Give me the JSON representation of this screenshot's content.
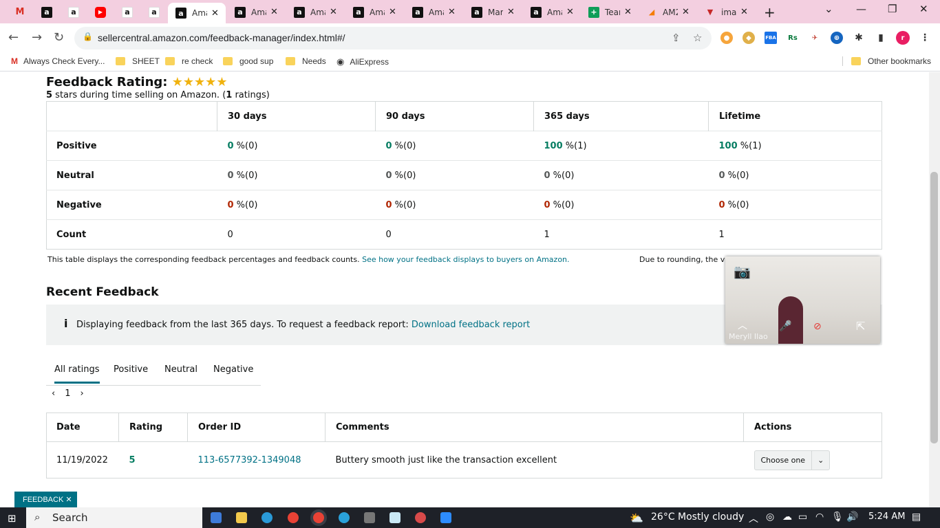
{
  "browser": {
    "tabs": [
      {
        "icon": "gmail-icon",
        "label": ""
      },
      {
        "icon": "amazon-icon",
        "label": ""
      },
      {
        "icon": "amazon-icon",
        "label": ""
      },
      {
        "icon": "youtube-icon",
        "label": ""
      },
      {
        "icon": "amazon-icon",
        "label": ""
      },
      {
        "icon": "amazon-icon",
        "label": ""
      },
      {
        "icon": "amazon-icon",
        "label": "Ama"
      },
      {
        "icon": "amazon-icon",
        "label": "Ama"
      },
      {
        "icon": "amazon-icon",
        "label": "Ama"
      },
      {
        "icon": "amazon-icon",
        "label": "Ama"
      },
      {
        "icon": "amazon-icon",
        "label": "Ama"
      },
      {
        "icon": "amazon-icon",
        "label": "Mar"
      },
      {
        "icon": "amazon-icon",
        "label": "Ama"
      },
      {
        "icon": "sheets-icon",
        "label": "Tear"
      },
      {
        "icon": "ams-icon",
        "label": "AM2"
      },
      {
        "icon": "image-icon",
        "label": "ima"
      }
    ],
    "url": "sellercentral.amazon.com/feedback-manager/index.html#/",
    "bookmarks": [
      "Always Check Every...",
      "SHEET",
      "re check",
      "good sup",
      "Needs",
      "AliExpress"
    ],
    "other_bookmarks": "Other bookmarks",
    "profile_initial": "r"
  },
  "feedback": {
    "title": "Feedback Rating:",
    "stars": "★★★★★",
    "subtitle_bold": "5",
    "subtitle_rest": " stars during time selling on Amazon. (",
    "ratings_count": "1",
    "ratings_suffix": " ratings)",
    "columns": [
      "30 days",
      "90 days",
      "365 days",
      "Lifetime"
    ],
    "rows": {
      "positive": {
        "label": "Positive",
        "pct": [
          "0",
          "0",
          "100",
          "100"
        ],
        "cnt": [
          " %(0)",
          " %(0)",
          " %(1)",
          " %(1)"
        ]
      },
      "neutral": {
        "label": "Neutral",
        "pct": [
          "0",
          "0",
          "0",
          "0"
        ],
        "cnt": [
          " %(0)",
          " %(0)",
          " %(0)",
          " %(0)"
        ]
      },
      "negative": {
        "label": "Negative",
        "pct": [
          "0",
          "0",
          "0",
          "0"
        ],
        "cnt": [
          " %(0)",
          " %(0)",
          " %(0)",
          " %(0)"
        ]
      },
      "count": {
        "label": "Count",
        "values": [
          "0",
          "0",
          "1",
          "1"
        ]
      }
    },
    "note": "This table displays the corresponding feedback percentages and feedback counts.",
    "note_link": "See how your feedback displays to buyers on Amazon.",
    "note_right": "Due to rounding, the va"
  },
  "recent": {
    "heading": "Recent Feedback",
    "info_icon": "i",
    "info_text": "Displaying feedback from the last 365 days. To request a feedback report:",
    "info_link": "Download feedback report",
    "tabs": [
      "All ratings",
      "Positive",
      "Neutral",
      "Negative"
    ],
    "page": "1",
    "table_headers": [
      "Date",
      "Rating",
      "Order ID",
      "Comments",
      "Actions"
    ],
    "rows": [
      {
        "date": "11/19/2022",
        "rating": "5",
        "order_id": "113-6577392-1349048",
        "comment": "Buttery smooth just like the transaction excellent",
        "action": "Choose one"
      }
    ]
  },
  "video_overlay": {
    "name": "Meryll Ilao"
  },
  "feedback_badge": "FEEDBACK ✕",
  "taskbar": {
    "search": "Search",
    "weather": "26°C  Mostly cloudy",
    "time": "5:24 AM"
  },
  "colors": {
    "positive": "#067d62",
    "negative": "#b12704",
    "link": "#007185",
    "tabbar": "#f3cfe0"
  }
}
